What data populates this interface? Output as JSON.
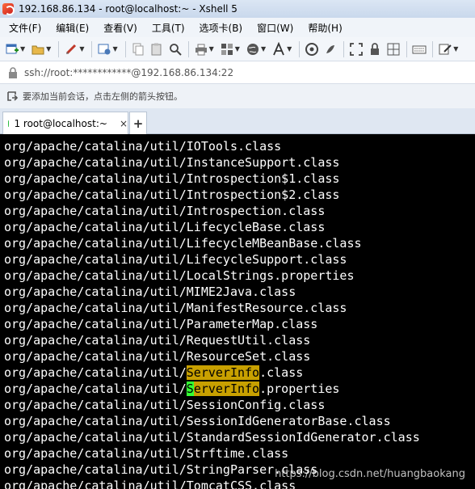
{
  "window": {
    "title": "192.168.86.134 - root@localhost:~ - Xshell 5"
  },
  "menu": {
    "items": [
      "文件(F)",
      "编辑(E)",
      "查看(V)",
      "工具(T)",
      "选项卡(B)",
      "窗口(W)",
      "帮助(H)"
    ]
  },
  "toolbar": {
    "icons": [
      "new-session-icon",
      "open-folder-icon",
      "link-icon",
      "properties-icon",
      "copy-icon",
      "paste-icon",
      "find-icon",
      "print-icon",
      "transfer-icon",
      "globe-icon",
      "font-icon",
      "xftp-icon",
      "script-icon",
      "fullscreen-icon",
      "lock-icon",
      "keyboard-icon",
      "compose-icon"
    ]
  },
  "address": {
    "text": "ssh://root:************@192.168.86.134:22"
  },
  "hint": {
    "text": "要添加当前会话，点击左侧的箭头按钮。"
  },
  "tabs": {
    "active": {
      "number": "1",
      "label": "root@localhost:~",
      "close": "×",
      "status_color": "#2bbd3f"
    },
    "add_label": "+"
  },
  "terminal": {
    "lines": [
      {
        "prefix": "org/apache/catalina/util/IOTools.class"
      },
      {
        "prefix": "org/apache/catalina/util/InstanceSupport.class"
      },
      {
        "prefix": "org/apache/catalina/util/Introspection$1.class"
      },
      {
        "prefix": "org/apache/catalina/util/Introspection$2.class"
      },
      {
        "prefix": "org/apache/catalina/util/Introspection.class"
      },
      {
        "prefix": "org/apache/catalina/util/LifecycleBase.class"
      },
      {
        "prefix": "org/apache/catalina/util/LifecycleMBeanBase.class"
      },
      {
        "prefix": "org/apache/catalina/util/LifecycleSupport.class"
      },
      {
        "prefix": "org/apache/catalina/util/LocalStrings.properties"
      },
      {
        "prefix": "org/apache/catalina/util/MIME2Java.class"
      },
      {
        "prefix": "org/apache/catalina/util/ManifestResource.class"
      },
      {
        "prefix": "org/apache/catalina/util/ParameterMap.class"
      },
      {
        "prefix": "org/apache/catalina/util/RequestUtil.class"
      },
      {
        "prefix": "org/apache/catalina/util/ResourceSet.class"
      },
      {
        "prefix": "org/apache/catalina/util/",
        "highlight": "ServerInfo",
        "suffix": ".class",
        "style": "yellow"
      },
      {
        "prefix": "org/apache/catalina/util/",
        "highlight_first": "S",
        "highlight": "erverInfo",
        "suffix": ".properties",
        "style": "green"
      },
      {
        "prefix": "org/apache/catalina/util/SessionConfig.class"
      },
      {
        "prefix": "org/apache/catalina/util/SessionIdGeneratorBase.class"
      },
      {
        "prefix": "org/apache/catalina/util/StandardSessionIdGenerator.class"
      },
      {
        "prefix": "org/apache/catalina/util/Strftime.class"
      },
      {
        "prefix": "org/apache/catalina/util/StringParser.class"
      },
      {
        "prefix": "org/apache/catalina/util/TomcatCSS.class"
      }
    ],
    "background": "#000000",
    "foreground": "#ffffff",
    "highlight_yellow": "#c8a000",
    "highlight_green": "#33ff33"
  },
  "watermark": "https://blog.csdn.net/huangbaokang"
}
